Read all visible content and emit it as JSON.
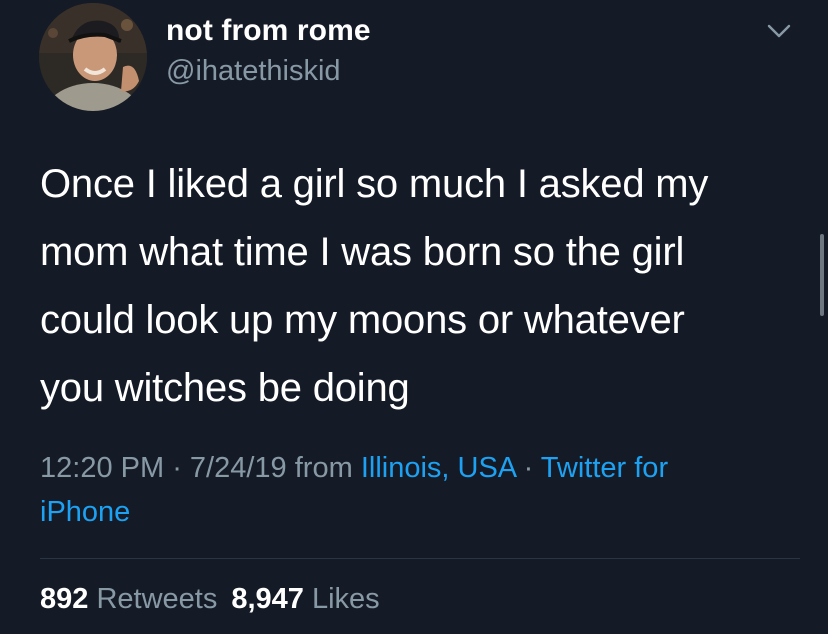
{
  "user": {
    "display_name": "not from rome",
    "handle": "@ihatethiskid"
  },
  "tweet": {
    "lines": [
      "Once I liked a girl so much I asked my",
      "mom what time I was born so the girl",
      "could look up my moons or whatever",
      "you witches be doing"
    ]
  },
  "meta": {
    "time": "12:20 PM",
    "separator": " · ",
    "date": "7/24/19",
    "from_text": " from ",
    "location": "Illinois, USA",
    "source_line1": "Twitter for",
    "source_line2": "iPhone"
  },
  "stats": {
    "retweets_count": "892",
    "retweets_label": "Retweets",
    "likes_count": "8,947",
    "likes_label": "Likes"
  },
  "colors": {
    "background": "#151b26",
    "secondary_text": "#8899a6",
    "link": "#1da1f2"
  },
  "icons": {
    "caret": "chevron-down-icon"
  }
}
